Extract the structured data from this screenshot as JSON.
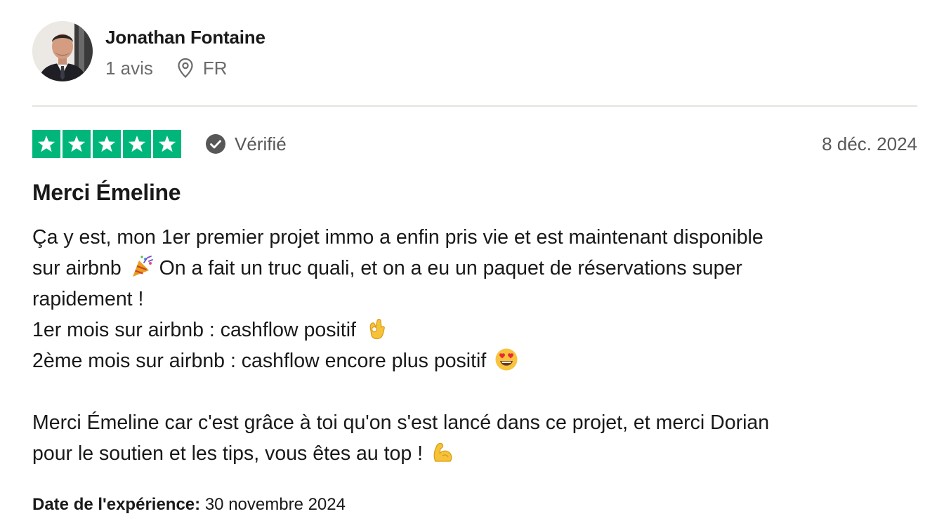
{
  "reviewer": {
    "name": "Jonathan Fontaine",
    "review_count": "1 avis",
    "country": "FR",
    "avatar_icon": "profile-photo",
    "pin_icon": "location-pin-icon"
  },
  "rating": {
    "stars": 5,
    "max_stars": 5,
    "star_color": "#00b67a",
    "verified_label": "Vérifié",
    "date": "8 déc. 2024"
  },
  "review": {
    "title": "Merci Émeline",
    "lines": [
      "Ça y est, mon 1er premier projet immo a enfin pris vie et est maintenant disponible",
      "sur airbnb",
      "On a fait un truc quali, et on a eu un paquet de réservations super",
      "rapidement !",
      "1er mois sur airbnb : cashflow positif",
      "2ème mois sur airbnb : cashflow encore plus positif",
      "Merci Émeline car c'est grâce à toi qu'on s'est lancé dans ce projet, et merci Dorian",
      "pour le soutien et les tips, vous êtes au top !"
    ],
    "emojis": [
      "party-popper-emoji",
      "ok-hand-emoji",
      "heart-eyes-emoji",
      "flexed-biceps-emoji"
    ]
  },
  "experience": {
    "label": "Date de l'expérience:",
    "date": "30 novembre 2024"
  }
}
